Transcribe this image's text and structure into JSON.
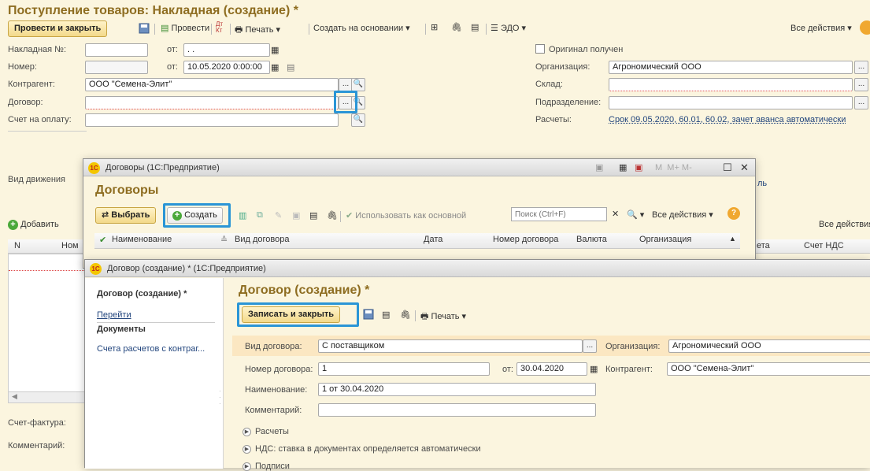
{
  "main": {
    "title": "Поступление товаров: Накладная (создание) *",
    "toolbar": {
      "post_close": "Провести и закрыть",
      "post": "Провести",
      "dtkt": "Дт/Кт",
      "print": "Печать",
      "create_base": "Создать на основании",
      "edo": "ЭДО",
      "all_actions": "Все действия"
    },
    "fields": {
      "invoice_no_label": "Накладная №:",
      "from_label": "от:",
      "invoice_date": " . .",
      "number_label": "Номер:",
      "number_date": "10.05.2020  0:00:00",
      "counterparty_label": "Контрагент:",
      "counterparty_value": "ООО \"Семена-Элит\"",
      "contract_label": "Договор:",
      "bill_label": "Счет на оплату:",
      "movement_label": "Вид движения",
      "original_label": "Оригинал получен",
      "org_label": "Организация:",
      "org_value": "Агрономический ООО",
      "warehouse_label": "Склад:",
      "division_label": "Подразделение:",
      "settlements_label": "Расчеты:",
      "settlements_value": "Срок 09.05.2020, 60.01, 60.02, зачет аванса автоматически",
      "change_link": "ль",
      "invoice_fact_label": "Счет-фактура:",
      "comment_label": "Комментарий:"
    },
    "table": {
      "add_button": "Добавить",
      "all_actions": "Все действия",
      "col_n": "N",
      "col_nom": "Ном",
      "col_acct": "ета",
      "col_vat_acct": "Счет НДС"
    }
  },
  "contracts_window": {
    "title": "Договоры (1С:Предприятие)",
    "heading": "Договоры",
    "select_button": "Выбрать",
    "create_button": "Создать",
    "use_as_main": "Использовать как основной",
    "search_placeholder": "Поиск (Ctrl+F)",
    "all_actions": "Все действия",
    "columns": [
      "Наименование",
      "Вид договора",
      "Дата",
      "Номер договора",
      "Валюта",
      "Организация"
    ]
  },
  "contract_window": {
    "title": "Договор (создание) * (1С:Предприятие)",
    "nav_title": "Договор (создание) *",
    "nav_goto": "Перейти",
    "nav_documents": "Документы",
    "nav_accounts": "Счета расчетов с контраг...",
    "heading": "Договор (создание) *",
    "save_close": "Записать и закрыть",
    "print": "Печать",
    "type_label": "Вид договора:",
    "type_value": "С поставщиком",
    "org_label": "Организация:",
    "org_value": "Агрономический ООО",
    "number_label": "Номер договора:",
    "number_value": "1",
    "date_label": "от:",
    "date_value": "30.04.2020",
    "counterparty_label": "Контрагент:",
    "counterparty_value": "ООО \"Семена-Элит\"",
    "name_label": "Наименование:",
    "name_value": "1 от 30.04.2020",
    "comment_label": "Комментарий:",
    "section_settlements": "Расчеты",
    "section_vat": "НДС: ставка в документах определяется автоматически",
    "section_signatures": "Подписи"
  }
}
